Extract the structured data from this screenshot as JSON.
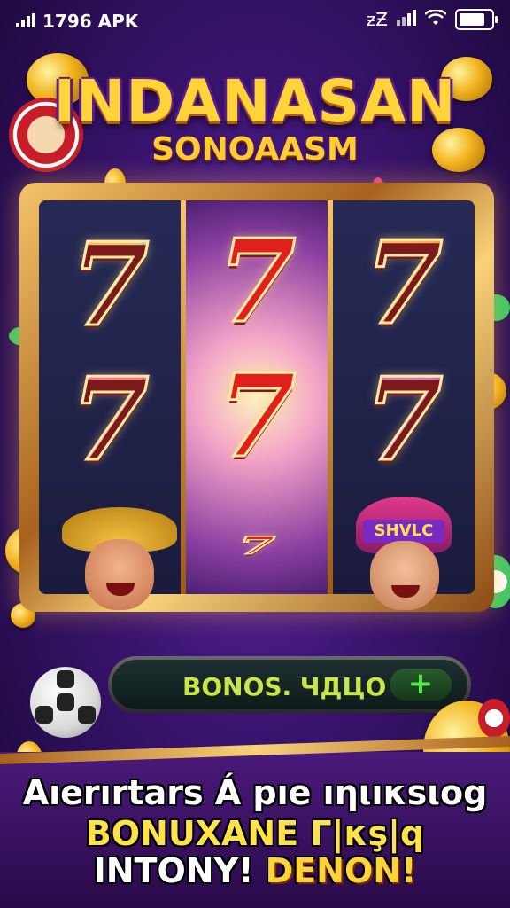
{
  "status_bar": {
    "left_text": "1796 APK",
    "right_text": "ƶƵ",
    "icons": [
      "signal-icon",
      "wifi-icon",
      "battery-icon"
    ]
  },
  "title": {
    "main": "INDANASAN",
    "sub": "SONOAASM"
  },
  "reels": {
    "symbol": "7",
    "left_hat_label": "",
    "right_helmet_label": "SHVLC"
  },
  "bonus": {
    "label": "BONOS. ЧДЦO",
    "plus_symbol": "+"
  },
  "promo": {
    "line1": "Aıerırtars Á pıe ıηιıκsιοg",
    "line2": "BONUXANE Γ|κş|q",
    "line3_a": "INTONY!",
    "line3_b": "DENON!"
  },
  "colors": {
    "background": "#3a1470",
    "title_gold": "#ffd43a",
    "bonus_text": "#c8e64a",
    "bonus_plus": "#5ae84a"
  }
}
